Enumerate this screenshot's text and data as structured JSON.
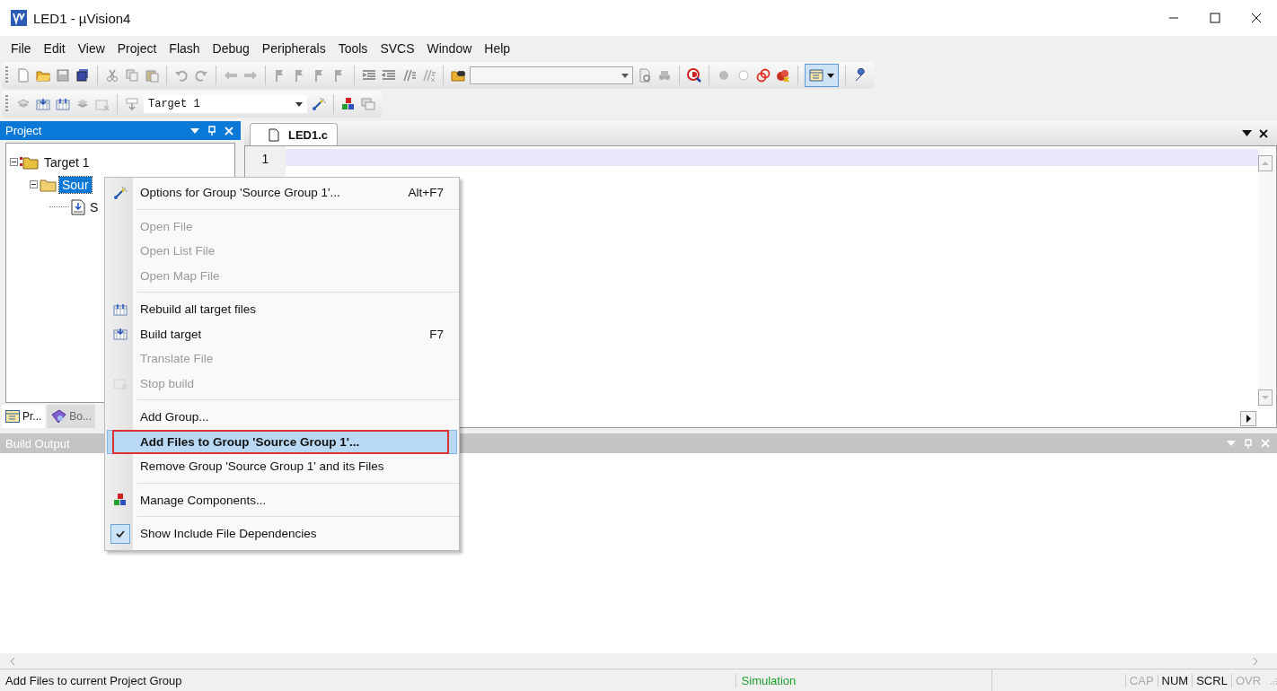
{
  "window": {
    "title": "LED1  - µVision4"
  },
  "menu_bar": [
    "File",
    "Edit",
    "View",
    "Project",
    "Flash",
    "Debug",
    "Peripherals",
    "Tools",
    "SVCS",
    "Window",
    "Help"
  ],
  "toolbar": {
    "target_select": {
      "value": "Target 1"
    }
  },
  "project_panel": {
    "title": "Project",
    "tree": [
      {
        "label": "Target 1",
        "expanded": true,
        "selected": false,
        "children": [
          {
            "label": "Sour",
            "expanded": true,
            "selected": true,
            "children": [
              {
                "label": "S",
                "selected": false
              }
            ]
          }
        ]
      }
    ],
    "tabs": [
      {
        "label": "Pr...",
        "selected": true
      },
      {
        "label": "Bo...",
        "selected": false
      }
    ]
  },
  "editor": {
    "tabs": [
      {
        "label": "LED1.c",
        "selected": true
      }
    ],
    "line_numbers": [
      "1"
    ]
  },
  "build_output": {
    "title": "Build Output"
  },
  "context_menu": [
    {
      "kind": "item",
      "label": "Options for Group 'Source Group 1'...",
      "shortcut": "Alt+F7",
      "disabled": false,
      "selected": false,
      "checked": false
    },
    {
      "kind": "separator"
    },
    {
      "kind": "item",
      "label": "Open File",
      "disabled": true,
      "selected": false,
      "checked": false
    },
    {
      "kind": "item",
      "label": "Open List File",
      "disabled": true,
      "selected": false,
      "checked": false
    },
    {
      "kind": "item",
      "label": "Open Map File",
      "disabled": true,
      "selected": false,
      "checked": false
    },
    {
      "kind": "separator"
    },
    {
      "kind": "item",
      "label": "Rebuild all target files",
      "disabled": false,
      "selected": false,
      "checked": false
    },
    {
      "kind": "item",
      "label": "Build target",
      "shortcut": "F7",
      "disabled": false,
      "selected": false,
      "checked": false
    },
    {
      "kind": "item",
      "label": "Translate File",
      "disabled": true,
      "selected": false,
      "checked": false
    },
    {
      "kind": "item",
      "label": "Stop build",
      "disabled": true,
      "selected": false,
      "checked": false
    },
    {
      "kind": "separator"
    },
    {
      "kind": "item",
      "label": "Add Group...",
      "disabled": false,
      "selected": false,
      "checked": false
    },
    {
      "kind": "item",
      "label": "Add Files to Group 'Source Group 1'...",
      "disabled": false,
      "selected": true,
      "checked": false
    },
    {
      "kind": "item",
      "label": "Remove Group 'Source Group 1' and its Files",
      "disabled": false,
      "selected": false,
      "checked": false
    },
    {
      "kind": "separator"
    },
    {
      "kind": "item",
      "label": "Manage Components...",
      "disabled": false,
      "selected": false,
      "checked": false
    },
    {
      "kind": "separator"
    },
    {
      "kind": "item",
      "label": "Show Include File Dependencies",
      "disabled": false,
      "selected": false,
      "checked": true
    }
  ],
  "status_bar": {
    "message": "Add Files to current Project Group",
    "mode": "Simulation",
    "indicators": [
      {
        "label": "CAP",
        "on": false
      },
      {
        "label": "NUM",
        "on": true
      },
      {
        "label": "SCRL",
        "on": true
      },
      {
        "label": "OVR",
        "on": false
      }
    ]
  }
}
